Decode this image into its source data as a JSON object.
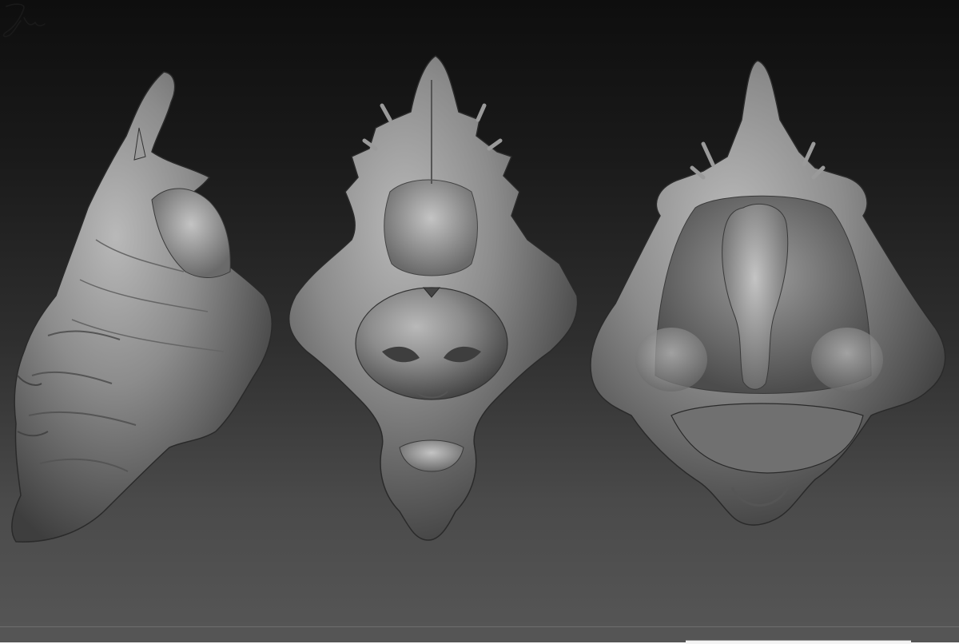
{
  "scene": {
    "background_top": "#0e0e0e",
    "background_bottom": "#555555",
    "sculpt_color": "#8a8a8a",
    "views": [
      {
        "id": "side",
        "icon": "creature-head-side-view"
      },
      {
        "id": "front",
        "icon": "creature-head-front-view"
      },
      {
        "id": "underside",
        "icon": "creature-head-underside-view"
      }
    ]
  },
  "signature": {
    "text": "Jul"
  }
}
